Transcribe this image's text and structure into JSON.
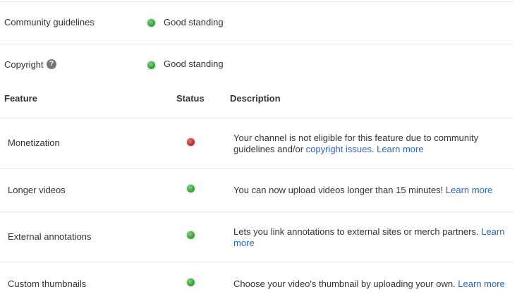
{
  "standing": {
    "community": {
      "label": "Community guidelines",
      "status": "Good standing"
    },
    "copyright": {
      "label": "Copyright",
      "status": "Good standing"
    }
  },
  "table": {
    "headers": {
      "feature": "Feature",
      "status": "Status",
      "description": "Description"
    },
    "rows": [
      {
        "feature": "Monetization",
        "status": "red",
        "desc_text": "Your channel is not eligible for this feature due to community guidelines and/or ",
        "link1": "copyright issues",
        "sep": ". ",
        "link2": "Learn more"
      },
      {
        "feature": "Longer videos",
        "status": "green",
        "desc_text": "You can now upload videos longer than 15 minutes! ",
        "link1": "Learn more"
      },
      {
        "feature": "External annotations",
        "status": "green",
        "desc_text": "Lets you link annotations to external sites or merch partners. ",
        "link1": "Learn more"
      },
      {
        "feature": "Custom thumbnails",
        "status": "green",
        "desc_text": "Choose your video's thumbnail by uploading your own. ",
        "link1": "Learn more"
      }
    ]
  },
  "colors": {
    "good": "#3fa33f",
    "bad": "#b73434",
    "link": "#2b66c4",
    "divider": "#e5e5e5"
  },
  "icons": {
    "help": "question-mark-circle"
  }
}
